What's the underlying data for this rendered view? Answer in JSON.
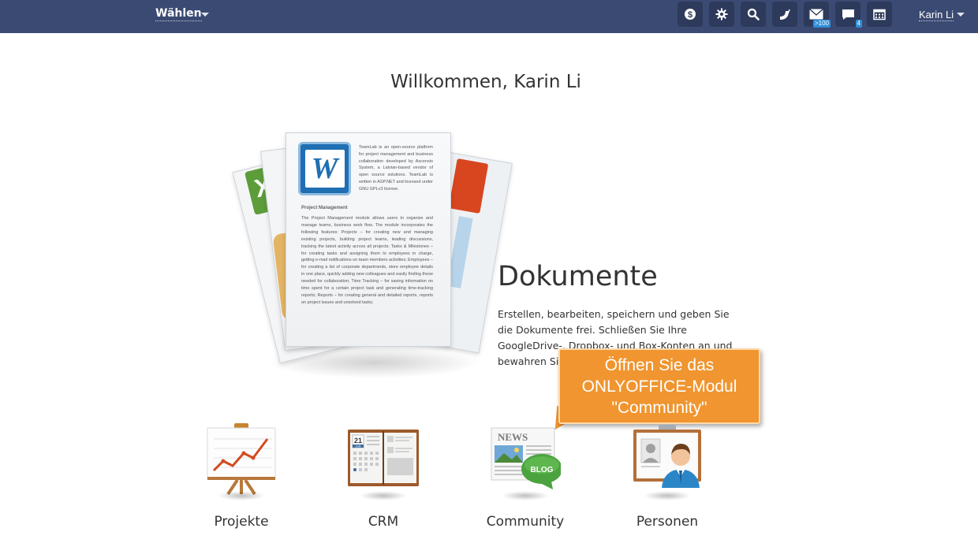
{
  "topbar": {
    "choose_label": "Wählen",
    "user_name": "Karin Li",
    "buttons": [
      {
        "name": "payments-icon"
      },
      {
        "name": "settings-icon"
      },
      {
        "name": "search-icon"
      },
      {
        "name": "feed-icon"
      },
      {
        "name": "mail-icon",
        "badge": ">100"
      },
      {
        "name": "chat-icon",
        "badge": "4"
      },
      {
        "name": "calendar-icon"
      }
    ],
    "colors": {
      "bar": "#3b4a72",
      "button": "#2d3a5c",
      "badge": "#2f8fd8"
    }
  },
  "welcome": "Willkommen, Karin Li",
  "featured": {
    "title": "Dokumente",
    "description": "Erstellen, bearbeiten, speichern und geben Sie die Dokumente frei. Schließen Sie Ihre GoogleDrive-, Dropbox- und Box-Konten an und bewahren Sie alle Dokumente an",
    "illustration": {
      "logo_letter": "W",
      "excel_letter": "X",
      "intro": "TeamLab is an open-source platform for project management and business collaboration developed by Ascensio System, a Latvian-based vendor of open source solutions. TeamLab is written in ASP.NET and licensed under GNU GPLv3 license.",
      "heading": "Project Management",
      "body": "The Project Management module allows users to organize and manage teams, business work flow. The module incorporates the following features: Projects – for creating new and managing existing projects, building project teams, leading discussions, tracking the latest activity across all projects; Tasks & Milestones – for creating tasks and assigning them to employees in charge, getting e-mail notifications on team members activities; Employees – for creating a list of corporate departments, store employee details in one place, quickly adding new colleagues and easily finding those needed for collaboration; Time Tracking – for saving information on time spent for a certain project task and generating time-tracking reports; Reports – for creating general and detailed reports, reports on project issues and unsolved tasks;"
    }
  },
  "callout": {
    "line1": "Öffnen Sie das",
    "line2": "ONLYOFFICE-Modul",
    "line3": "\"Community\"",
    "color": "#f0952f"
  },
  "modules": [
    {
      "label": "Projekte",
      "icon": "presentation-chart-icon"
    },
    {
      "label": "CRM",
      "icon": "address-book-icon",
      "calendar_day": "21",
      "calendar_month": "JUN"
    },
    {
      "label": "Community",
      "icon": "news-blog-icon",
      "news_text": "NEWS",
      "blog_text": "BLOG"
    },
    {
      "label": "Personen",
      "icon": "people-card-icon"
    }
  ]
}
